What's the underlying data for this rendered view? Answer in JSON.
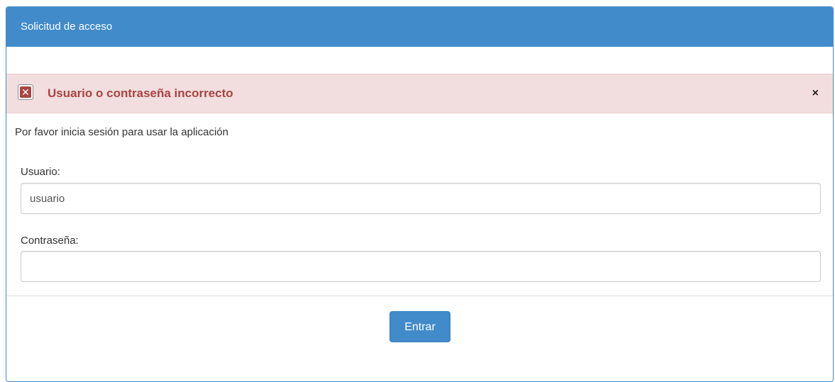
{
  "panel": {
    "title": "Solicitud de acceso"
  },
  "alert": {
    "icon": "error-x-icon",
    "icon_glyph": "✕",
    "message": "Usuario o contraseña incorrecto",
    "close_glyph": "×",
    "background": "#f2dede",
    "text_color": "#a94442"
  },
  "form": {
    "intro": "Por favor inicia sesión para usar la aplicación",
    "username_label": "Usuario:",
    "username_value": "usuario",
    "password_label": "Contraseña:",
    "password_value": ""
  },
  "footer": {
    "submit_label": "Entrar"
  },
  "colors": {
    "primary": "#428bca"
  }
}
